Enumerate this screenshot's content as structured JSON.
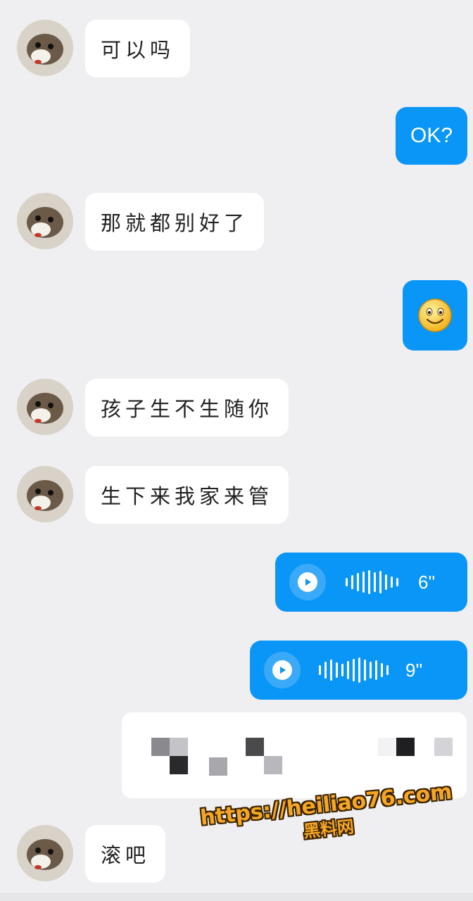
{
  "colors": {
    "background": "#efeff1",
    "outgoing_bubble": "#0a96f7",
    "incoming_bubble": "#ffffff",
    "watermark": "#f5a623"
  },
  "messages": [
    {
      "from": "them",
      "type": "text",
      "text": "可以吗"
    },
    {
      "from": "me",
      "type": "text",
      "text": "OK?"
    },
    {
      "from": "them",
      "type": "text",
      "text": "那就都别好了"
    },
    {
      "from": "me",
      "type": "emoji",
      "icon": "smiley-face-icon"
    },
    {
      "from": "them",
      "type": "text",
      "text": "孩子生不生随你"
    },
    {
      "from": "them",
      "type": "text",
      "text": "生下来我家来管"
    },
    {
      "from": "me",
      "type": "voice",
      "duration": "6''"
    },
    {
      "from": "me",
      "type": "voice",
      "duration": "9''"
    },
    {
      "from": "them",
      "type": "redacted"
    },
    {
      "from": "them",
      "type": "text",
      "text": "滚吧"
    }
  ],
  "watermark": {
    "url": "https://heiliao76.com",
    "name": "黑料网"
  }
}
